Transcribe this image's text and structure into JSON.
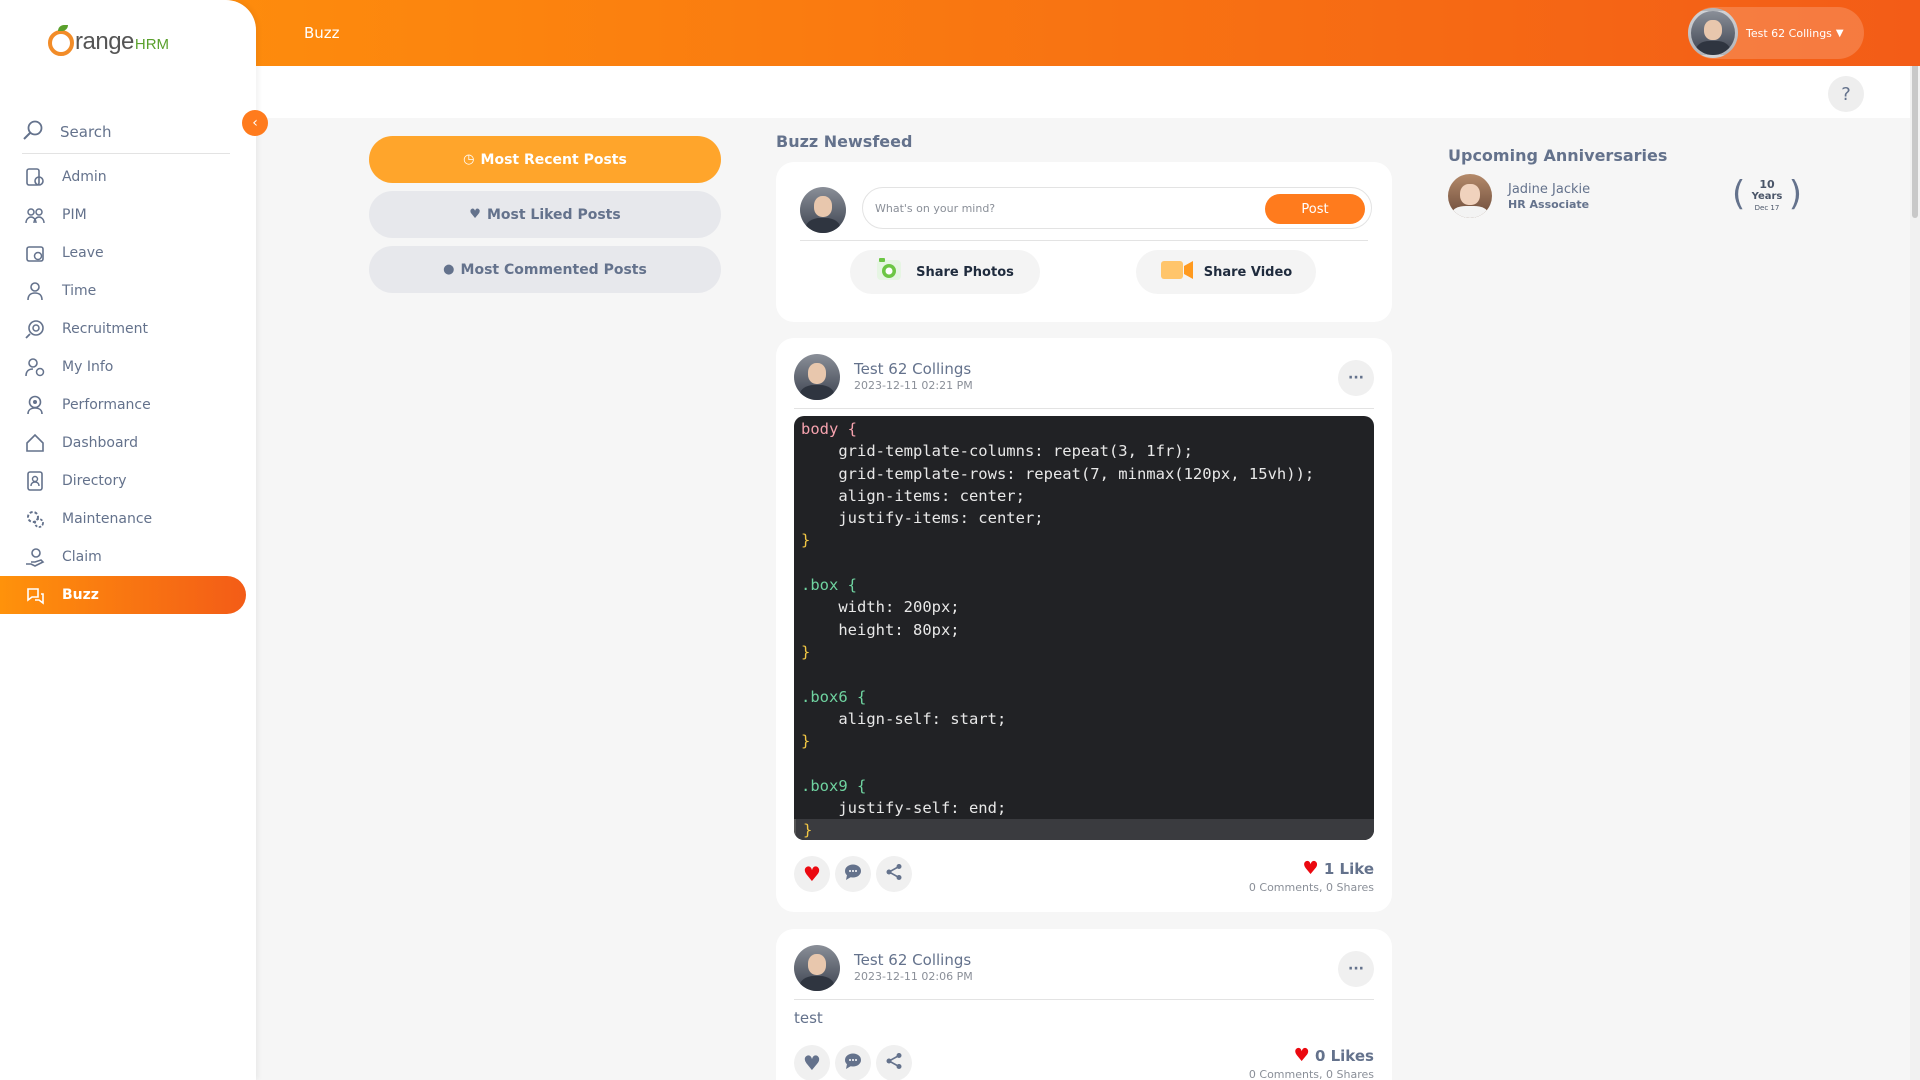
{
  "app": {
    "logo_text": "range",
    "logo_hrm": "HRM",
    "page_title": "Buzz"
  },
  "user": {
    "name": "Test 62 Collings"
  },
  "sidebar": {
    "search_label": "Search",
    "items": [
      {
        "label": "Admin",
        "icon": "admin-icon"
      },
      {
        "label": "PIM",
        "icon": "pim-icon"
      },
      {
        "label": "Leave",
        "icon": "leave-icon"
      },
      {
        "label": "Time",
        "icon": "time-icon"
      },
      {
        "label": "Recruitment",
        "icon": "recruitment-icon"
      },
      {
        "label": "My Info",
        "icon": "my-info-icon"
      },
      {
        "label": "Performance",
        "icon": "performance-icon"
      },
      {
        "label": "Dashboard",
        "icon": "dashboard-icon"
      },
      {
        "label": "Directory",
        "icon": "directory-icon"
      },
      {
        "label": "Maintenance",
        "icon": "maintenance-icon"
      },
      {
        "label": "Claim",
        "icon": "claim-icon"
      },
      {
        "label": "Buzz",
        "icon": "buzz-icon",
        "active": true
      }
    ]
  },
  "help": {
    "label": "?"
  },
  "filters": {
    "most_recent": "Most Recent Posts",
    "most_liked": "Most Liked Posts",
    "most_commented": "Most Commented Posts"
  },
  "feed": {
    "title": "Buzz Newsfeed",
    "composer": {
      "placeholder": "What's on your mind?",
      "post_label": "Post",
      "share_photos": "Share Photos",
      "share_video": "Share Video"
    },
    "posts": [
      {
        "author": "Test 62 Collings",
        "time": "2023-12-11 02:21 PM",
        "code": [
          "body {",
          "    grid-template-columns: repeat(3, 1fr);",
          "    grid-template-rows: repeat(7, minmax(120px, 15vh));",
          "    align-items: center;",
          "    justify-items: center;",
          "}",
          "",
          ".box {",
          "    width: 200px;",
          "    height: 80px;",
          "}",
          "",
          ".box6 {",
          "    align-self: start;",
          "}",
          "",
          ".box9 {",
          "    justify-self: end;",
          "}"
        ],
        "likes": "1 Like",
        "comments": "0 Comments",
        "shares": "0 Shares",
        "liked": true
      },
      {
        "author": "Test 62 Collings",
        "time": "2023-12-11 02:06 PM",
        "text": "test",
        "likes": "0 Likes",
        "comments": "0 Comments",
        "shares": "0 Shares",
        "liked": false
      }
    ]
  },
  "anniversaries": {
    "title": "Upcoming Anniversaries",
    "items": [
      {
        "name": "Jadine Jackie",
        "role": "HR Associate",
        "years": "10",
        "years_label": "Years",
        "date": "Dec 17"
      }
    ]
  },
  "colors": {
    "accent": "#ff7b1d",
    "accent_light": "#ffa52b",
    "heart": "#eb0910",
    "text": "#64728c"
  }
}
